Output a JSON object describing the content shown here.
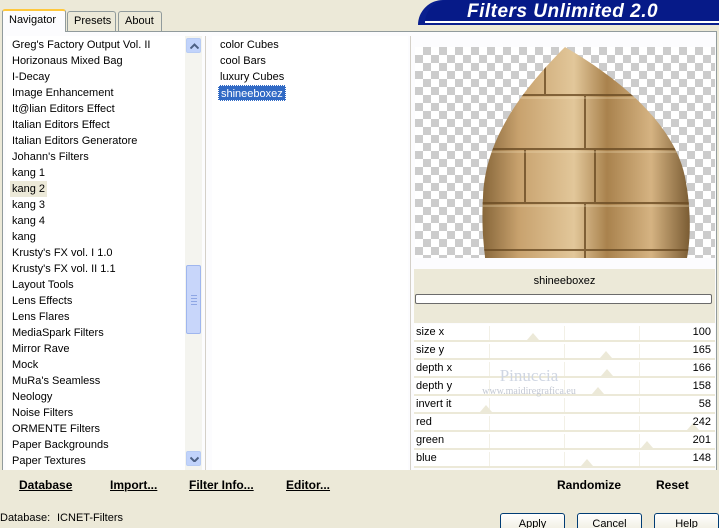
{
  "tabs": [
    {
      "label": "Navigator",
      "active": true
    },
    {
      "label": "Presets",
      "active": false
    },
    {
      "label": "About",
      "active": false
    }
  ],
  "banner": {
    "title": "Filters Unlimited 2.0"
  },
  "categories": [
    "Greg's Factory Output Vol. II",
    "Horizonaus Mixed Bag",
    "I-Decay",
    "Image Enhancement",
    "It@lian Editors Effect",
    "Italian Editors Effect",
    "Italian Editors Generatore",
    "Johann's Filters",
    "kang 1",
    "kang 2",
    "kang 3",
    "kang 4",
    "kang",
    "Krusty's FX vol. I 1.0",
    "Krusty's FX vol. II 1.1",
    "Layout Tools",
    "Lens Effects",
    "Lens Flares",
    "MediaSpark Filters",
    "Mirror Rave",
    "Mock",
    "MuRa's Seamless",
    "Neology",
    "Noise Filters",
    "ORMENTE Filters",
    "Paper Backgrounds",
    "Paper Textures"
  ],
  "selected_category": "kang 2",
  "filters": [
    "color Cubes",
    "cool Bars",
    "luxury Cubes",
    "shineeboxez"
  ],
  "selected_filter": "shineeboxez",
  "filter_name": "shineeboxez",
  "sliders": [
    {
      "label": "size x",
      "value": "100",
      "level": 100
    },
    {
      "label": "size y",
      "value": "165",
      "level": 165
    },
    {
      "label": "depth x",
      "value": "166",
      "level": 166
    },
    {
      "label": "depth y",
      "value": "158",
      "level": 158
    },
    {
      "label": "invert it",
      "value": "58",
      "level": 58
    },
    {
      "label": "red",
      "value": "242",
      "level": 242
    },
    {
      "label": "green",
      "value": "201",
      "level": 201
    },
    {
      "label": "blue",
      "value": "148",
      "level": 148
    }
  ],
  "watermark": {
    "name": "Pinuccia",
    "url": "www.maidiregrafica.eu"
  },
  "bottom_bar": {
    "database": "Database",
    "import": "Import...",
    "filter_info": "Filter Info...",
    "editor": "Editor...",
    "randomize": "Randomize",
    "reset": "Reset"
  },
  "status": {
    "database_label": "Database:",
    "database_value": "ICNET-Filters"
  },
  "buttons": {
    "apply": "Apply",
    "cancel": "Cancel",
    "help": "Help"
  },
  "colors": {
    "selection": "#316ac5",
    "banner": "#061a88",
    "preview_fill": "#b38a55"
  }
}
